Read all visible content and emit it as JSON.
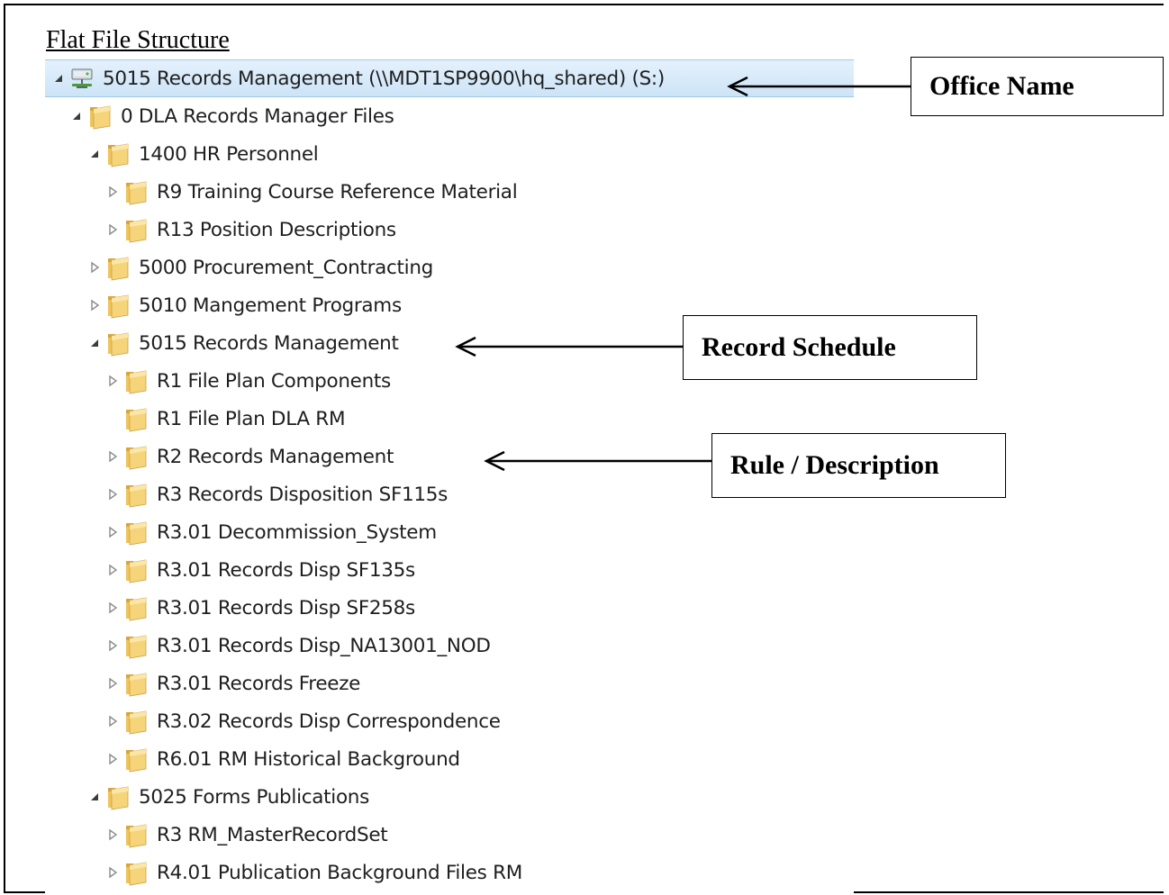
{
  "heading": "Flat File Structure",
  "tree": [
    {
      "label": "5015 Records Management (\\\\MDT1SP9900\\hq_shared) (S:)",
      "icon": "network-drive-icon",
      "expander": "expanded",
      "selected": true,
      "level": 0
    },
    {
      "label": "0 DLA Records Manager Files",
      "icon": "folder-icon",
      "expander": "expanded",
      "level": 1
    },
    {
      "label": "1400 HR Personnel",
      "icon": "folder-icon",
      "expander": "expanded",
      "level": 2
    },
    {
      "label": "R9 Training Course Reference Material",
      "icon": "folder-icon",
      "expander": "collapsed",
      "level": 3
    },
    {
      "label": "R13 Position Descriptions",
      "icon": "folder-icon",
      "expander": "collapsed",
      "level": 3
    },
    {
      "label": "5000 Procurement_Contracting",
      "icon": "folder-icon",
      "expander": "collapsed",
      "level": 2
    },
    {
      "label": "5010 Mangement Programs",
      "icon": "folder-icon",
      "expander": "collapsed",
      "level": 2
    },
    {
      "label": "5015 Records Management",
      "icon": "folder-icon",
      "expander": "expanded",
      "level": 2
    },
    {
      "label": "R1 File Plan Components",
      "icon": "folder-icon",
      "expander": "collapsed",
      "level": 3
    },
    {
      "label": "R1 File Plan DLA RM",
      "icon": "folder-icon",
      "expander": "none",
      "level": 3
    },
    {
      "label": "R2 Records Management",
      "icon": "folder-icon",
      "expander": "collapsed",
      "level": 3
    },
    {
      "label": "R3 Records Disposition SF115s",
      "icon": "folder-icon",
      "expander": "collapsed",
      "level": 3
    },
    {
      "label": "R3.01 Decommission_System",
      "icon": "folder-icon",
      "expander": "collapsed",
      "level": 3
    },
    {
      "label": "R3.01 Records Disp SF135s",
      "icon": "folder-icon",
      "expander": "collapsed",
      "level": 3
    },
    {
      "label": "R3.01 Records Disp SF258s",
      "icon": "folder-icon",
      "expander": "collapsed",
      "level": 3
    },
    {
      "label": "R3.01 Records Disp_NA13001_NOD",
      "icon": "folder-icon",
      "expander": "collapsed",
      "level": 3
    },
    {
      "label": "R3.01 Records Freeze",
      "icon": "folder-icon",
      "expander": "collapsed",
      "level": 3
    },
    {
      "label": "R3.02 Records Disp Correspondence",
      "icon": "folder-icon",
      "expander": "collapsed",
      "level": 3
    },
    {
      "label": "R6.01 RM Historical Background",
      "icon": "folder-icon",
      "expander": "collapsed",
      "level": 3
    },
    {
      "label": "5025 Forms Publications",
      "icon": "folder-icon",
      "expander": "expanded",
      "level": 2
    },
    {
      "label": "R3 RM_MasterRecordSet",
      "icon": "folder-icon",
      "expander": "collapsed",
      "level": 3
    },
    {
      "label": "R4.01 Publication Background Files RM",
      "icon": "folder-icon",
      "expander": "collapsed",
      "level": 3
    }
  ],
  "callouts": {
    "office_name": "Office Name",
    "record_schedule": "Record Schedule",
    "rule_description": "Rule / Description"
  },
  "colors": {
    "selection": "#cce4f7",
    "folder": "#e8b84a",
    "text": "#1e1e1e"
  }
}
